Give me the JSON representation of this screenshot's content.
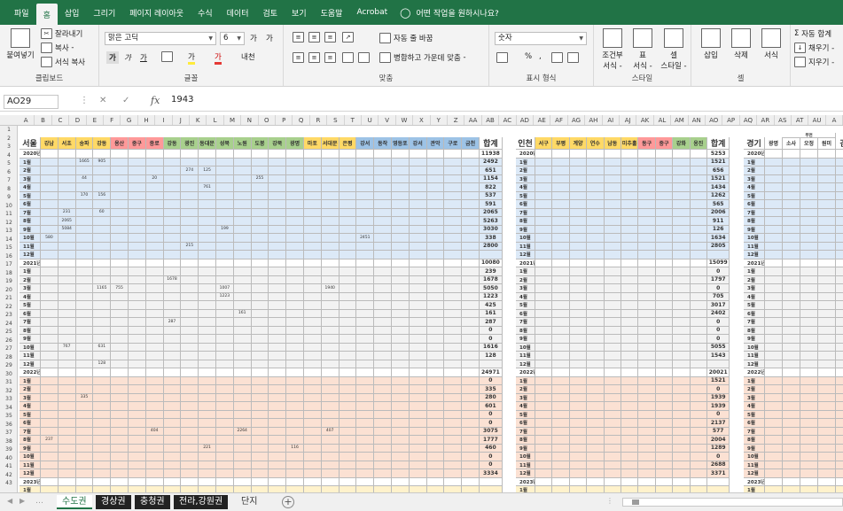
{
  "menu_tabs": [
    "파일",
    "홈",
    "삽입",
    "그리기",
    "페이지 레이아웃",
    "수식",
    "데이터",
    "검토",
    "보기",
    "도움말",
    "Acrobat"
  ],
  "active_tab": 1,
  "tell_me": "어떤 작업을 원하시나요?",
  "ribbon": {
    "clipboard": {
      "paste": "붙여넣기",
      "cut": "잘라내기",
      "copy": "복사",
      "copy_arrow": "-",
      "format_painter": "서식 복사",
      "label": "클립보드"
    },
    "font": {
      "name": "맑은 고딕",
      "size": "6",
      "grow": "가",
      "shrink": "가",
      "bold": "가",
      "italic": "가",
      "underline": "가",
      "fill_letter": "가",
      "font_color_letter": "가",
      "phonetic": "내천",
      "label": "글꼴"
    },
    "align": {
      "wrap": "자동 줄 바꿈",
      "merge": "병합하고 가운데 맞춤",
      "merge_arrow": "-",
      "label": "맞춤"
    },
    "number": {
      "format": "숫자",
      "label": "표시 형식",
      "pct": "%",
      "comma": ","
    },
    "styles": {
      "cond": "조건부",
      "cond2": "서식 -",
      "table": "표",
      "table2": "서식 -",
      "cell": "셀",
      "cell2": "스타일 -",
      "label": "스타일"
    },
    "cells": {
      "insert": "삽입",
      "delete": "삭제",
      "format": "서식",
      "label": "셀"
    },
    "edit": {
      "autosum": "자동 합계",
      "fill": "채우기 -",
      "clear": "지우기 -"
    }
  },
  "formula_bar": {
    "name_box": "AO29",
    "fx": "fx",
    "value": "1943"
  },
  "columns": [
    "A",
    "B",
    "C",
    "D",
    "E",
    "F",
    "G",
    "H",
    "I",
    "J",
    "K",
    "L",
    "M",
    "N",
    "O",
    "P",
    "Q",
    "R",
    "S",
    "T",
    "U",
    "V",
    "W",
    "X",
    "Y",
    "Z",
    "AA",
    "AB",
    "AC",
    "AD",
    "AE",
    "AF",
    "AG",
    "AH",
    "AI",
    "AJ",
    "AK",
    "AL",
    "AM",
    "AN",
    "AO",
    "AP",
    "AQ",
    "AR",
    "AS",
    "AT",
    "AU",
    "A"
  ],
  "sheet": {
    "seoul": {
      "title": "서울",
      "headers": [
        "강남",
        "서초",
        "송파",
        "강동",
        "용산",
        "중구",
        "종로",
        "강동",
        "광진",
        "동대문",
        "성북",
        "노원",
        "도봉",
        "강북",
        "광명",
        "마포",
        "서대문",
        "은평",
        "강서",
        "동작",
        "영등포",
        "강서",
        "관악",
        "구로",
        "금천",
        "합계"
      ],
      "header_colors": [
        "#ffd966",
        "#ffd966",
        "#ffd966",
        "#ffd966",
        "#ff9999",
        "#ff9999",
        "#ff9999",
        "#a8d08d",
        "#a8d08d",
        "#a8d08d",
        "#a8d08d",
        "#a8d08d",
        "#a8d08d",
        "#a8d08d",
        "#a8d08d",
        "#ffd966",
        "#ffd966",
        "#ffd966",
        "#9dc3e6",
        "#9dc3e6",
        "#9dc3e6",
        "#9dc3e6",
        "#9dc3e6",
        "#9dc3e6",
        "#9dc3e6",
        "#ffffff"
      ]
    },
    "incheon": {
      "title": "인천",
      "headers": [
        "서구",
        "부평",
        "계양",
        "연수",
        "남동",
        "미추홀",
        "동구",
        "중구",
        "강화",
        "옹진",
        "합계"
      ],
      "header_colors": [
        "#ffd966",
        "#ffd966",
        "#ffd966",
        "#ffd966",
        "#ffd966",
        "#ffd966",
        "#ff9999",
        "#ff9999",
        "#a8d08d",
        "#a8d08d",
        "#ffffff"
      ]
    },
    "gyeonggi": {
      "title": "경기",
      "headers": [
        "광명",
        "소사",
        "오정",
        "원미",
        "김포"
      ],
      "sub_header": "부천"
    },
    "year_labels": [
      "2020년",
      "2021년",
      "2022년",
      "2023년"
    ],
    "months": [
      "1월",
      "2월",
      "3월",
      "4월",
      "5월",
      "6월",
      "7월",
      "8월",
      "9월",
      "10월",
      "11월",
      "12월"
    ],
    "block_colors": [
      "#dce9f7",
      "#f2f2f2",
      "#fbe1d3",
      "#fff2cc"
    ],
    "seoul_values": [
      [
        [
          "",
          "",
          "1665",
          "905",
          "",
          "",
          "",
          "",
          "",
          "",
          "",
          "",
          "",
          "",
          "",
          "",
          "",
          "",
          "",
          "",
          "",
          "",
          "",
          "",
          "",
          ""
        ],
        [
          "",
          "",
          "",
          "",
          "",
          "",
          "",
          "",
          "274",
          "125",
          "",
          "",
          "",
          "",
          "",
          "",
          "",
          "",
          "",
          "",
          "",
          "",
          "",
          "",
          "",
          ""
        ],
        [
          "",
          "",
          "44",
          "",
          "",
          "",
          "20",
          "",
          "",
          "",
          "",
          "",
          "255",
          "",
          "",
          "",
          "",
          "",
          "",
          "",
          "",
          "",
          "",
          "",
          "",
          ""
        ],
        [
          "",
          "",
          "",
          "",
          "",
          "",
          "",
          "",
          "",
          "761",
          "",
          "",
          "",
          "",
          "",
          "",
          "",
          "",
          "",
          "",
          "",
          "",
          "",
          "",
          "",
          ""
        ],
        [
          "",
          "",
          "170",
          "156",
          "",
          "",
          "",
          "",
          "",
          "",
          "",
          "",
          "",
          "",
          "",
          "",
          "",
          "",
          "",
          "",
          "",
          "",
          "",
          "",
          "",
          ""
        ],
        [
          "",
          "",
          "",
          "",
          "",
          "",
          "",
          "",
          "",
          "",
          "",
          "",
          "",
          "",
          "",
          "",
          "",
          "",
          "",
          "",
          "",
          "",
          "",
          "",
          "",
          ""
        ],
        [
          "",
          "231",
          "",
          "60",
          "",
          "",
          "",
          "",
          "",
          "",
          "",
          "",
          "",
          "",
          "",
          "",
          "",
          "",
          "",
          "",
          "",
          "",
          "",
          "",
          "",
          ""
        ],
        [
          "",
          "2065",
          "",
          "",
          "",
          "",
          "",
          "",
          "",
          "",
          "",
          "",
          "",
          "",
          "",
          "",
          "",
          "",
          "",
          "",
          "",
          "",
          "",
          "",
          "",
          ""
        ],
        [
          "",
          "5084",
          "",
          "",
          "",
          "",
          "",
          "",
          "",
          "",
          "199",
          "",
          "",
          "",
          "",
          "",
          "",
          "",
          "",
          "",
          "",
          "",
          "",
          "",
          "",
          ""
        ],
        [
          "580",
          "",
          "",
          "",
          "",
          "",
          "",
          "",
          "",
          "",
          "",
          "",
          "",
          "",
          "",
          "",
          "",
          "",
          "2451",
          "",
          "",
          "",
          "",
          "",
          "",
          ""
        ],
        [
          "",
          "",
          "",
          "",
          "",
          "",
          "",
          "",
          "215",
          "",
          "",
          "",
          "",
          "",
          "",
          "",
          "",
          "",
          "",
          "",
          "",
          "",
          "",
          "",
          "",
          ""
        ],
        [
          "",
          "",
          "",
          "",
          "",
          "",
          "",
          "",
          "",
          "",
          "",
          "",
          "",
          "",
          "",
          "",
          "",
          "",
          "",
          "",
          "",
          "",
          "",
          "",
          "",
          ""
        ]
      ],
      [
        [
          "",
          "",
          "",
          "",
          "",
          "",
          "",
          "",
          "",
          "",
          "",
          "",
          "",
          "",
          "",
          "",
          "",
          "",
          "",
          "",
          "",
          "",
          "",
          "",
          "",
          ""
        ],
        [
          "",
          "",
          "",
          "",
          "",
          "",
          "",
          "1678",
          "",
          "",
          "",
          "",
          "",
          "",
          "",
          "",
          "",
          "",
          "",
          "",
          "",
          "",
          "",
          "",
          "",
          ""
        ],
        [
          "",
          "",
          "",
          "1165",
          "755",
          "",
          "",
          "",
          "",
          "",
          "1007",
          "",
          "",
          "",
          "",
          "",
          "1940",
          "",
          "",
          "",
          "",
          "",
          "",
          "",
          "",
          ""
        ],
        [
          "",
          "",
          "",
          "",
          "",
          "",
          "",
          "",
          "",
          "",
          "1223",
          "",
          "",
          "",
          "",
          "",
          "",
          "",
          "",
          "",
          "",
          "",
          "",
          "",
          "",
          ""
        ],
        [
          "",
          "",
          "",
          "",
          "",
          "",
          "",
          "",
          "",
          "",
          "",
          "",
          "",
          "",
          "",
          "",
          "",
          "",
          "",
          "",
          "",
          "",
          "",
          "",
          "",
          ""
        ],
        [
          "",
          "",
          "",
          "",
          "",
          "",
          "",
          "",
          "",
          "",
          "",
          "161",
          "",
          "",
          "",
          "",
          "",
          "",
          "",
          "",
          "",
          "",
          "",
          "",
          "",
          ""
        ],
        [
          "",
          "",
          "",
          "",
          "",
          "",
          "",
          "287",
          "",
          "",
          "",
          "",
          "",
          "",
          "",
          "",
          "",
          "",
          "",
          "",
          "",
          "",
          "",
          "",
          "",
          ""
        ],
        [
          "",
          "",
          "",
          "",
          "",
          "",
          "",
          "",
          "",
          "",
          "",
          "",
          "",
          "",
          "",
          "",
          "",
          "",
          "",
          "",
          "",
          "",
          "",
          "",
          "",
          ""
        ],
        [
          "",
          "",
          "",
          "",
          "",
          "",
          "",
          "",
          "",
          "",
          "",
          "",
          "",
          "",
          "",
          "",
          "",
          "",
          "",
          "",
          "",
          "",
          "",
          "",
          "",
          ""
        ],
        [
          "",
          "767",
          "",
          "631",
          "",
          "",
          "",
          "",
          "",
          "",
          "",
          "",
          "",
          "",
          "",
          "",
          "",
          "",
          "",
          "",
          "",
          "",
          "",
          "",
          "",
          ""
        ],
        [
          "",
          "",
          "",
          "",
          "",
          "",
          "",
          "",
          "",
          "",
          "",
          "",
          "",
          "",
          "",
          "",
          "",
          "",
          "",
          "",
          "",
          "",
          "",
          "",
          "",
          ""
        ],
        [
          "",
          "",
          "",
          "128",
          "",
          "",
          "",
          "",
          "",
          "",
          "",
          "",
          "",
          "",
          "",
          "",
          "",
          "",
          "",
          "",
          "",
          "",
          "",
          "",
          "",
          ""
        ]
      ],
      [
        [
          "",
          "",
          "",
          "",
          "",
          "",
          "",
          "",
          "",
          "",
          "",
          "",
          "",
          "",
          "",
          "",
          "",
          "",
          "",
          "",
          "",
          "",
          "",
          "",
          "",
          ""
        ],
        [
          "",
          "",
          "",
          "",
          "",
          "",
          "",
          "",
          "",
          "",
          "",
          "",
          "",
          "",
          "",
          "",
          "",
          "",
          "",
          "",
          "",
          "",
          "",
          "",
          "",
          ""
        ],
        [
          "",
          "",
          "335",
          "",
          "",
          "",
          "",
          "",
          "",
          "",
          "",
          "",
          "",
          "",
          "",
          "",
          "",
          "",
          "",
          "",
          "",
          "",
          "",
          "",
          "",
          ""
        ],
        [
          "",
          "",
          "",
          "",
          "",
          "",
          "",
          "",
          "",
          "",
          "",
          "",
          "",
          "",
          "",
          "",
          "",
          "",
          "",
          "",
          "",
          "",
          "",
          "",
          "",
          ""
        ],
        [
          "",
          "",
          "",
          "",
          "",
          "",
          "",
          "",
          "",
          "",
          "",
          "",
          "",
          "",
          "",
          "",
          "",
          "",
          "",
          "",
          "",
          "",
          "",
          "",
          "",
          ""
        ],
        [
          "",
          "",
          "",
          "",
          "",
          "",
          "",
          "",
          "",
          "",
          "",
          "",
          "",
          "",
          "",
          "",
          "",
          "",
          "",
          "",
          "",
          "",
          "",
          "",
          "",
          ""
        ],
        [
          "",
          "",
          "",
          "",
          "",
          "",
          "404",
          "",
          "",
          "",
          "",
          "2264",
          "",
          "",
          "",
          "",
          "407",
          "",
          "",
          "",
          "",
          "",
          "",
          "",
          "",
          ""
        ],
        [
          "237",
          "",
          "",
          "",
          "",
          "",
          "",
          "",
          "",
          "",
          "",
          "",
          "",
          "",
          "",
          "",
          "",
          "",
          "",
          "",
          "",
          "",
          "",
          "",
          "",
          ""
        ],
        [
          "",
          "",
          "",
          "",
          "",
          "",
          "",
          "",
          "",
          "221",
          "",
          "",
          "",
          "",
          "116",
          "",
          "",
          "",
          "",
          "",
          "",
          "",
          "",
          "",
          "",
          ""
        ],
        [
          "",
          "",
          "",
          "",
          "",
          "",
          "",
          "",
          "",
          "",
          "",
          "",
          "",
          "",
          "",
          "",
          "",
          "",
          "",
          "",
          "",
          "",
          "",
          "",
          "",
          ""
        ],
        [
          "",
          "",
          "",
          "",
          "",
          "",
          "",
          "",
          "",
          "",
          "",
          "",
          "",
          "",
          "",
          "",
          "",
          "",
          "",
          "",
          "",
          "",
          "",
          "",
          "",
          ""
        ],
        [
          "",
          "",
          "",
          "",
          "",
          "",
          "",
          "",
          "",
          "",
          "",
          "",
          "",
          "",
          "",
          "",
          "",
          "",
          "",
          "",
          "",
          "",
          "",
          "",
          "",
          ""
        ]
      ]
    ],
    "seoul_totals": [
      [
        "11938",
        "2492",
        "651",
        "1154",
        "822",
        "537",
        "591",
        "2065",
        "5263",
        "3030",
        "338",
        "2800"
      ],
      [
        "10080",
        "239",
        "1678",
        "5050",
        "1223",
        "425",
        "161",
        "287",
        "0",
        "0",
        "1616",
        "128"
      ],
      [
        "24971",
        "0",
        "335",
        "280",
        "601",
        "0",
        "0",
        "3075",
        "1777",
        "460",
        "0",
        "0",
        "3334"
      ]
    ],
    "incheon_totals": [
      [
        "5253",
        "1521",
        "656",
        "1521",
        "1434",
        "1262",
        "565",
        "2006",
        "911",
        "126",
        "1634",
        "2805"
      ],
      [
        "15099",
        "0",
        "1797",
        "0",
        "705",
        "3017",
        "2402",
        "0",
        "0",
        "0",
        "5055",
        "1543"
      ],
      [
        "20021",
        "1521",
        "0",
        "1939",
        "1939",
        "0",
        "2137",
        "577",
        "2004",
        "1289",
        "0",
        "2688",
        "3371"
      ]
    ]
  },
  "sheets": [
    "수도권",
    "경상권",
    "충청권",
    "전라,강원권",
    "단지"
  ],
  "active_sheet": 0
}
